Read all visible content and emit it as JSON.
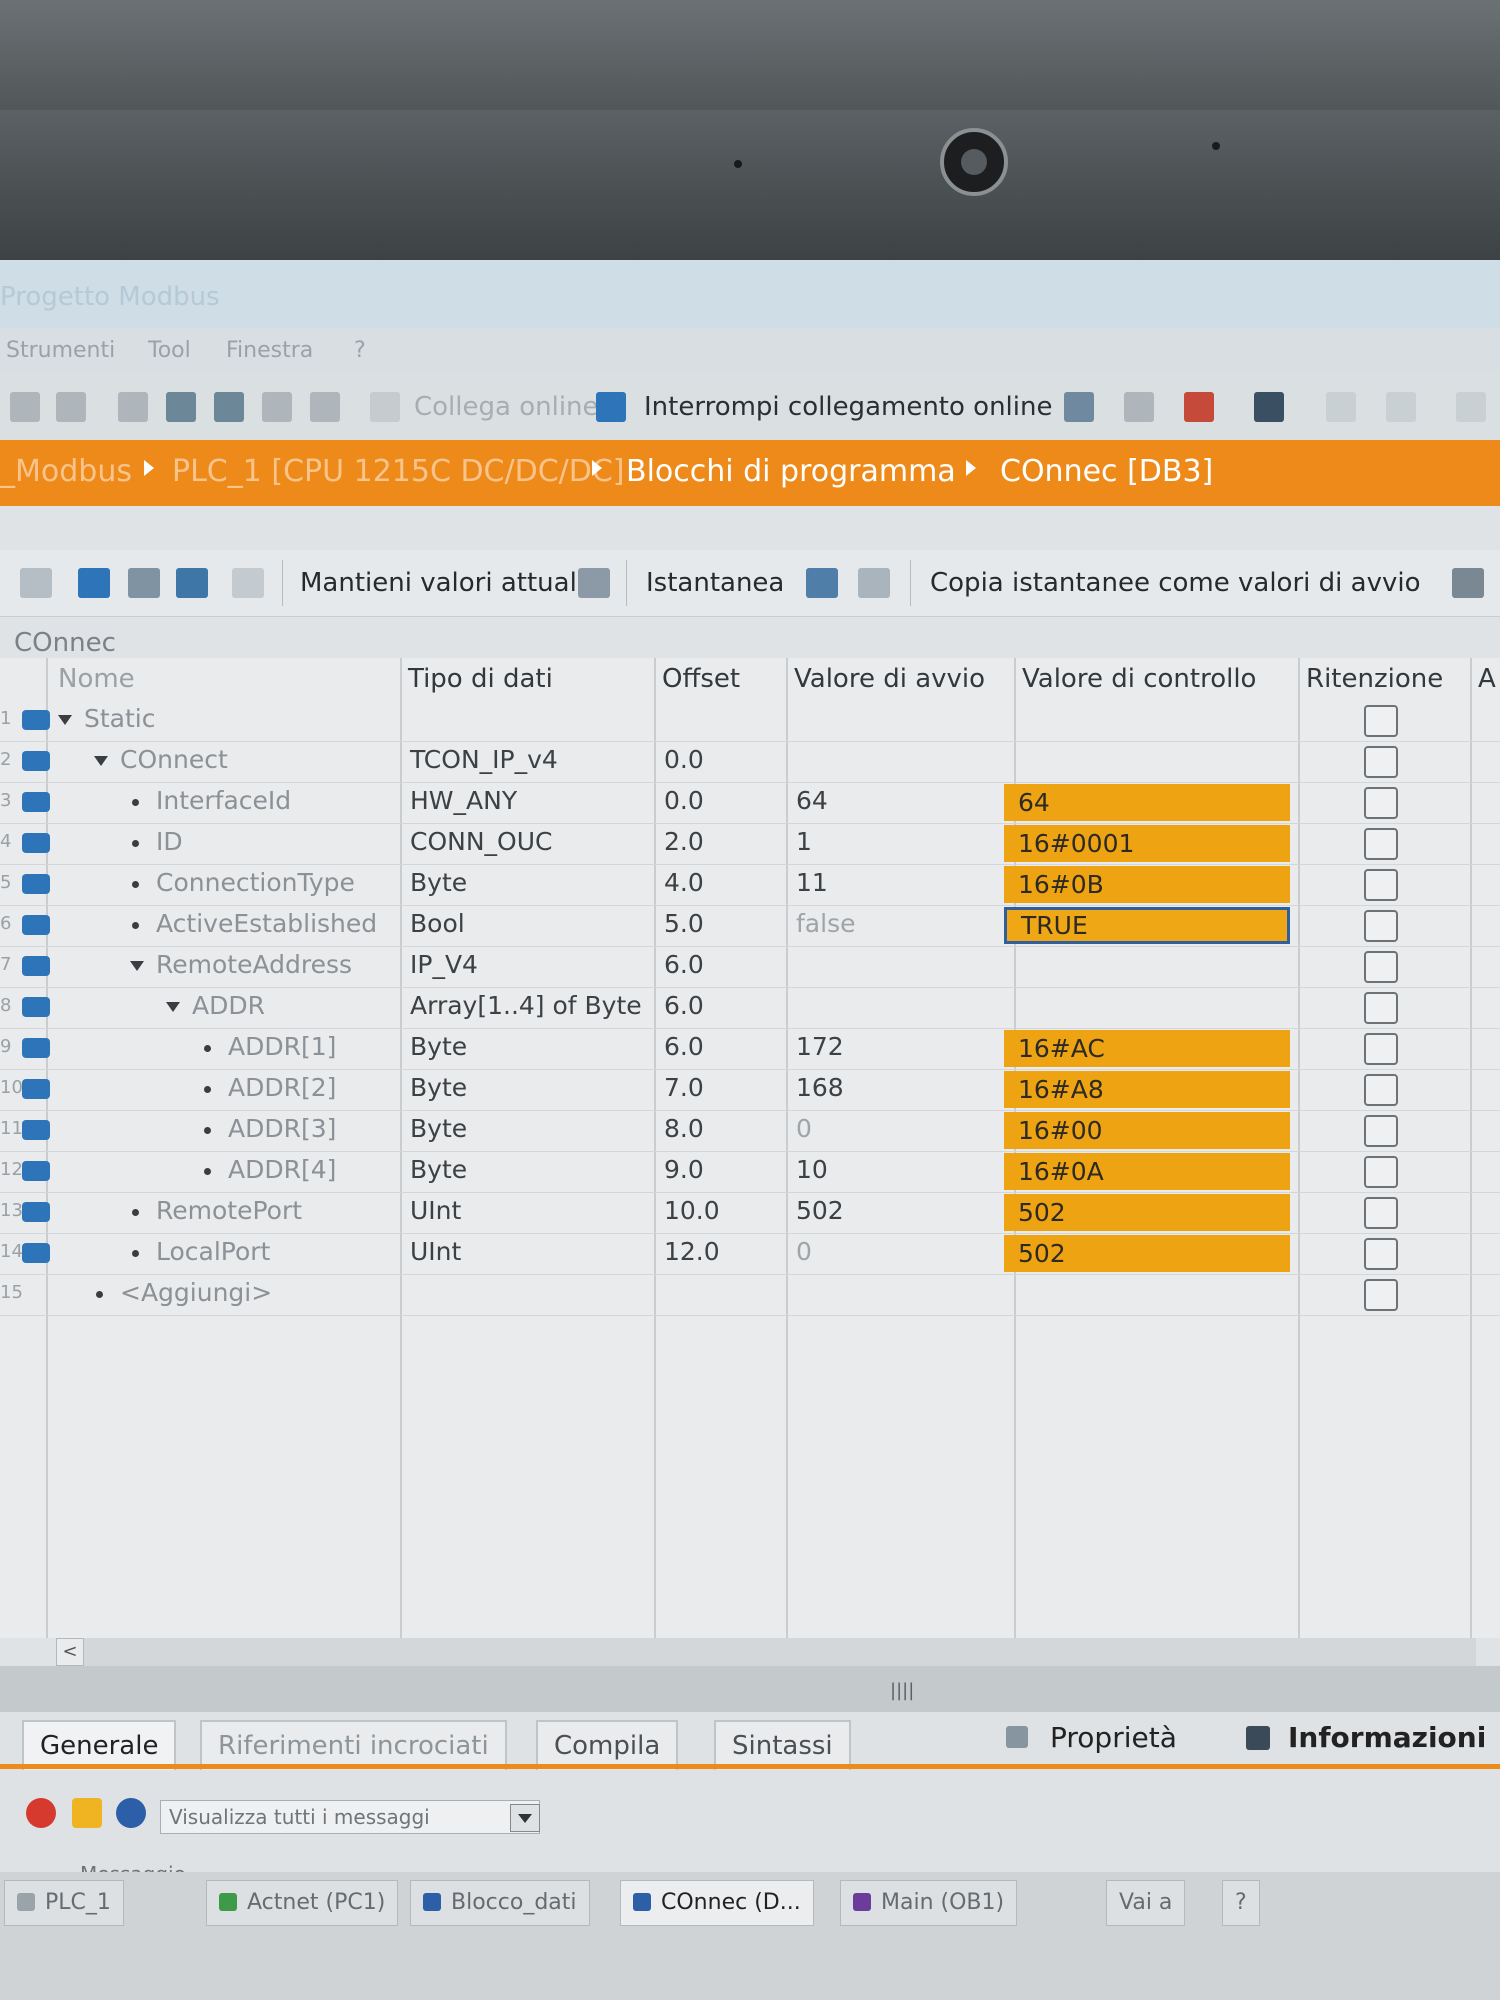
{
  "window": {
    "title": "Progetto Modbus"
  },
  "menu": {
    "items": [
      "Strumenti",
      "Tool",
      "Finestra",
      "?"
    ]
  },
  "toolbar": {
    "go_online": "Collega online",
    "go_offline": "Interrompi collegamento online"
  },
  "breadcrumb": {
    "items": [
      "_Modbus",
      "PLC_1 [CPU 1215C DC/DC/DC]",
      "Blocchi di programma",
      "COnnec [DB3]"
    ]
  },
  "editor_toolbar": {
    "keep_actual": "Mantieni valori attuali",
    "snapshot": "Istantanea",
    "copy_snapshot": "Copia istantanee come valori di avvio"
  },
  "block": {
    "title": "COnnec"
  },
  "table": {
    "headers": [
      "Nome",
      "Tipo di dati",
      "Offset",
      "Valore di avvio",
      "Valore di controllo",
      "Ritenzione",
      "A"
    ],
    "rows": [
      {
        "num": "1",
        "name": "Static",
        "type": "",
        "offset": "",
        "start": "",
        "monitor": ""
      },
      {
        "num": "2",
        "name": "COnnect",
        "type": "TCON_IP_v4",
        "offset": "0.0",
        "start": "",
        "monitor": ""
      },
      {
        "num": "3",
        "name": "InterfaceId",
        "type": "HW_ANY",
        "offset": "0.0",
        "start": "64",
        "monitor": "64"
      },
      {
        "num": "4",
        "name": "ID",
        "type": "CONN_OUC",
        "offset": "2.0",
        "start": "1",
        "monitor": "16#0001"
      },
      {
        "num": "5",
        "name": "ConnectionType",
        "type": "Byte",
        "offset": "4.0",
        "start": "11",
        "monitor": "16#0B"
      },
      {
        "num": "6",
        "name": "ActiveEstablished",
        "type": "Bool",
        "offset": "5.0",
        "start": "false",
        "monitor": "TRUE"
      },
      {
        "num": "7",
        "name": "RemoteAddress",
        "type": "IP_V4",
        "offset": "6.0",
        "start": "",
        "monitor": ""
      },
      {
        "num": "8",
        "name": "ADDR",
        "type": "Array[1..4] of Byte",
        "offset": "6.0",
        "start": "",
        "monitor": ""
      },
      {
        "num": "9",
        "name": "ADDR[1]",
        "type": "Byte",
        "offset": "6.0",
        "start": "172",
        "monitor": "16#AC"
      },
      {
        "num": "10",
        "name": "ADDR[2]",
        "type": "Byte",
        "offset": "7.0",
        "start": "168",
        "monitor": "16#A8"
      },
      {
        "num": "11",
        "name": "ADDR[3]",
        "type": "Byte",
        "offset": "8.0",
        "start": "0",
        "monitor": "16#00"
      },
      {
        "num": "12",
        "name": "ADDR[4]",
        "type": "Byte",
        "offset": "9.0",
        "start": "10",
        "monitor": "16#0A"
      },
      {
        "num": "13",
        "name": "RemotePort",
        "type": "UInt",
        "offset": "10.0",
        "start": "502",
        "monitor": "502"
      },
      {
        "num": "14",
        "name": "LocalPort",
        "type": "UInt",
        "offset": "12.0",
        "start": "0",
        "monitor": "502"
      },
      {
        "num": "15",
        "name": "<Aggiungi>",
        "type": "",
        "offset": "",
        "start": "",
        "monitor": ""
      }
    ]
  },
  "inspector": {
    "tabs": [
      "Generale",
      "Riferimenti incrociati",
      "Compila",
      "Sintassi"
    ],
    "right_tabs": [
      "Proprietà",
      "Informazioni"
    ],
    "filter": "Visualizza tutti i messaggi",
    "message_header": "Messaggio"
  },
  "taskbar": {
    "items": [
      "PLC_1",
      "Actnet (PC1)",
      "Blocco_dati",
      "COnnec (D...",
      "Main (OB1)"
    ],
    "goto": "Vai a",
    "help": "?"
  },
  "colors": {
    "accent": "#ee8a1a",
    "monitor_cell": "#eda312",
    "icon_blue": "#2d74b8"
  }
}
